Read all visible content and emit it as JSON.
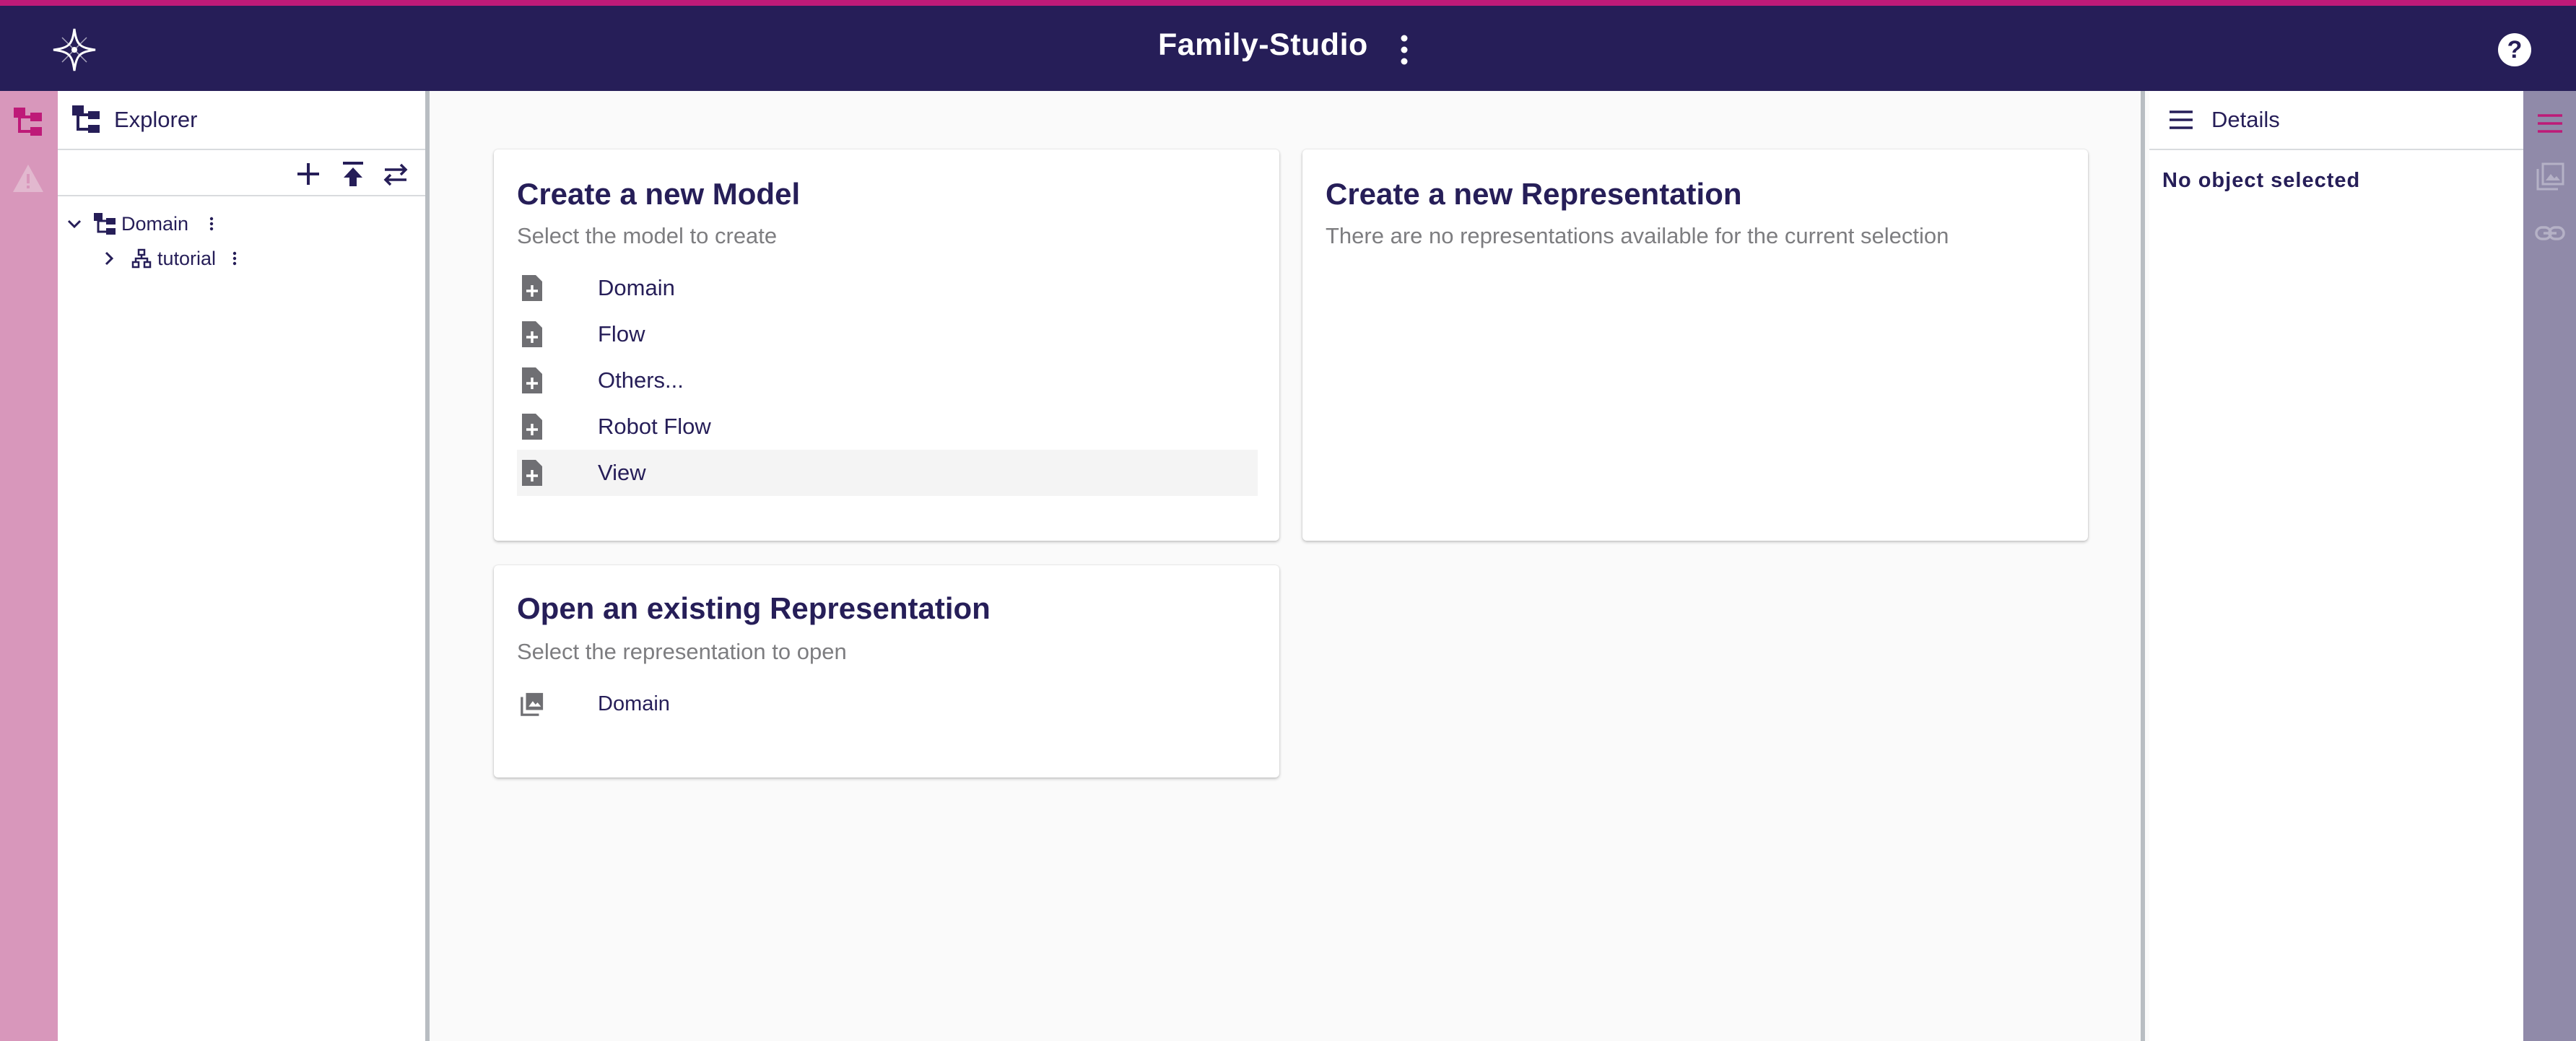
{
  "header": {
    "title": "Family-Studio",
    "menu_icon": "more-vertical-icon",
    "help_icon": "help-icon",
    "help_label": "?"
  },
  "colors": {
    "header_bg": "#261e58",
    "accent": "#be1a78",
    "left_rail": "#d897bb",
    "right_rail": "#908aa9"
  },
  "left_rail": {
    "items": [
      {
        "icon": "explorer-tree-icon"
      },
      {
        "icon": "warning-icon"
      }
    ]
  },
  "explorer": {
    "title": "Explorer",
    "tools": [
      {
        "icon": "add-icon"
      },
      {
        "icon": "upload-icon"
      },
      {
        "icon": "swap-icon"
      }
    ],
    "tree": [
      {
        "label": "Domain",
        "expanded": true,
        "icon": "tree-structure-icon"
      },
      {
        "label": "tutorial",
        "expanded": false,
        "icon": "hierarchy-icon"
      }
    ]
  },
  "main": {
    "new_model": {
      "title": "Create a new Model",
      "subtitle": "Select the model to create",
      "items": [
        "Domain",
        "Flow",
        "Others...",
        "Robot Flow",
        "View"
      ],
      "selected": "View"
    },
    "new_representation": {
      "title": "Create a new Representation",
      "subtitle": "There are no representations available for the current selection"
    },
    "open_representation": {
      "title": "Open an existing Representation",
      "subtitle": "Select the representation to open",
      "items": [
        "Domain"
      ]
    }
  },
  "details": {
    "title": "Details",
    "empty_text": "No object selected"
  },
  "right_rail": {
    "items": [
      {
        "icon": "menu-icon"
      },
      {
        "icon": "images-icon"
      },
      {
        "icon": "link-icon"
      }
    ]
  }
}
